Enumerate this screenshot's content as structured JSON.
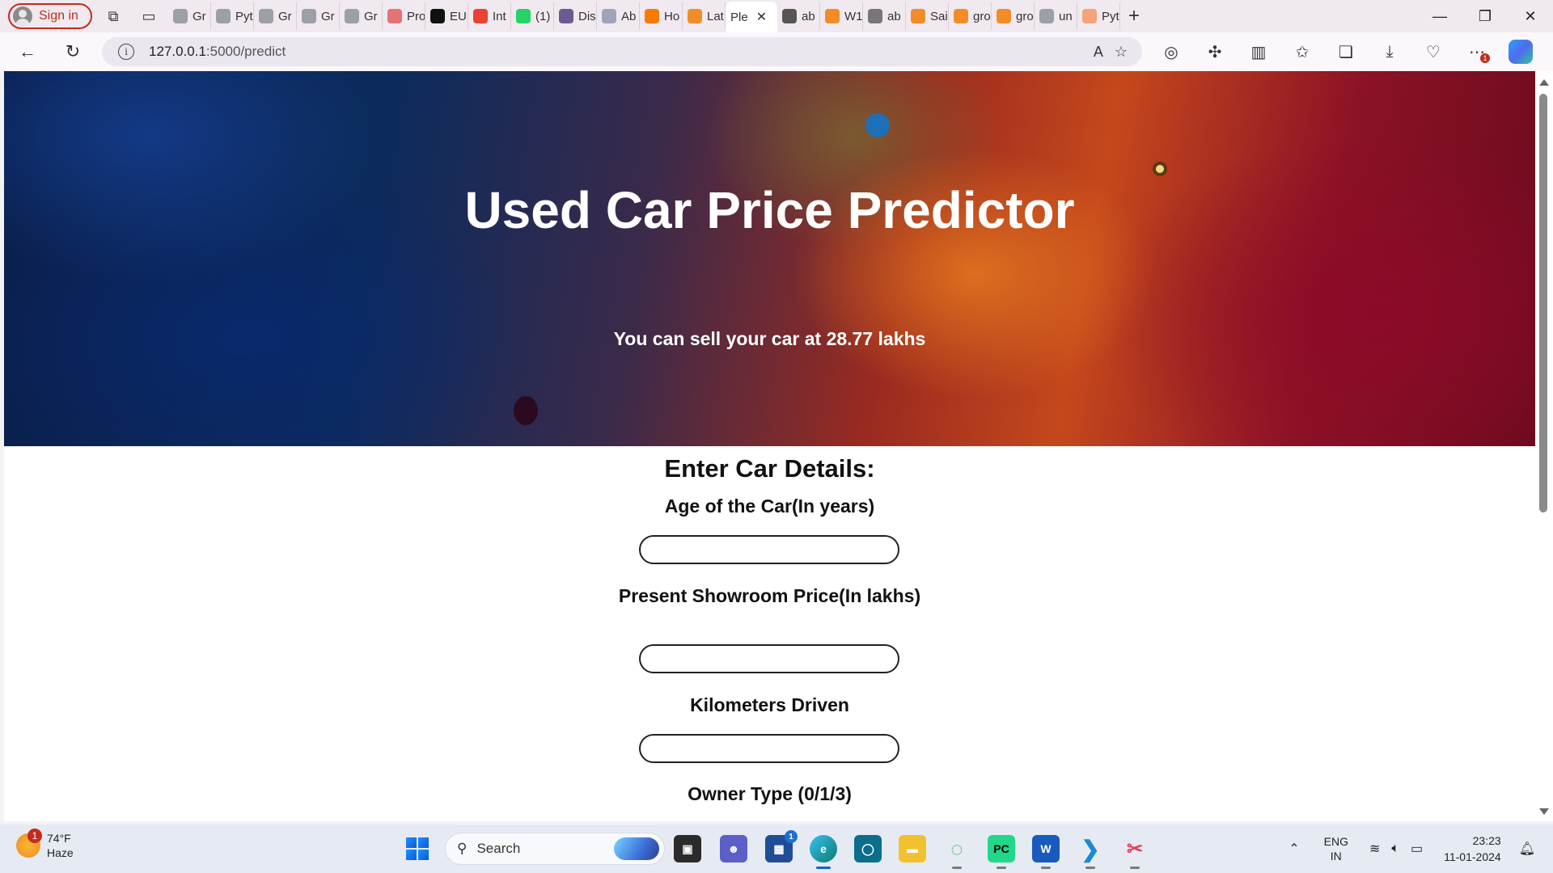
{
  "browser": {
    "signin_label": "Sign in",
    "tabs": [
      {
        "label": "Gr",
        "icon": "google-icon",
        "color": "#9aa0a6"
      },
      {
        "label": "Pyt",
        "icon": "google-icon",
        "color": "#9aa0a6"
      },
      {
        "label": "Gr",
        "icon": "google-icon",
        "color": "#9aa0a6"
      },
      {
        "label": "Gr",
        "icon": "google-icon",
        "color": "#9aa0a6"
      },
      {
        "label": "Gr",
        "icon": "google-icon",
        "color": "#9aa0a6"
      },
      {
        "label": "Pro",
        "icon": "pdf-icon",
        "color": "#e57373"
      },
      {
        "label": "EU",
        "icon": "tv-icon",
        "color": "#111111"
      },
      {
        "label": "Int",
        "icon": "gmail-icon",
        "color": "#ea4335"
      },
      {
        "label": "(1)",
        "icon": "whatsapp-icon",
        "color": "#25d366"
      },
      {
        "label": "Dis",
        "icon": "site-icon",
        "color": "#6b5b95"
      },
      {
        "label": "Ab",
        "icon": "site-icon",
        "color": "#a0a4b8"
      },
      {
        "label": "Ho",
        "icon": "loading-icon",
        "color": "#f57c00"
      },
      {
        "label": "Lat",
        "icon": "overleaf-icon",
        "color": "#f28c28"
      },
      {
        "label": "Ple",
        "icon": "page-icon",
        "color": "#ffffff",
        "active": true
      },
      {
        "label": "ab",
        "icon": "document-icon",
        "color": "#555555"
      },
      {
        "label": "W1",
        "icon": "overleaf-icon",
        "color": "#f28c28"
      },
      {
        "label": "ab",
        "icon": "document-icon",
        "color": "#777777"
      },
      {
        "label": "Sai",
        "icon": "overleaf-icon",
        "color": "#f28c28"
      },
      {
        "label": "gro",
        "icon": "overleaf-icon",
        "color": "#f28c28"
      },
      {
        "label": "gro",
        "icon": "overleaf-icon",
        "color": "#f28c28"
      },
      {
        "label": "un",
        "icon": "search-icon",
        "color": "#9aa0a6"
      },
      {
        "label": "Pyt",
        "icon": "site-icon",
        "color": "#f4a37a"
      }
    ],
    "url_host": "127.0.0.1",
    "url_path": ":5000/predict"
  },
  "page": {
    "title": "Used Car Price Predictor",
    "result": "You can sell your car at 28.77 lakhs",
    "form_heading": "Enter Car Details:",
    "fields": {
      "age_label": "Age of the Car(In years)",
      "age_value": "",
      "price_label": "Present Showroom Price(In lakhs)",
      "price_value": "",
      "km_label": "Kilometers Driven",
      "km_value": "",
      "owner_label": "Owner Type (0/1/3)"
    }
  },
  "taskbar": {
    "weather_temp": "74°F",
    "weather_desc": "Haze",
    "weather_badge": "1",
    "search_label": "Search",
    "store_badge": "1",
    "lang_line1": "ENG",
    "lang_line2": "IN",
    "time": "23:23",
    "date": "11-01-2024"
  }
}
